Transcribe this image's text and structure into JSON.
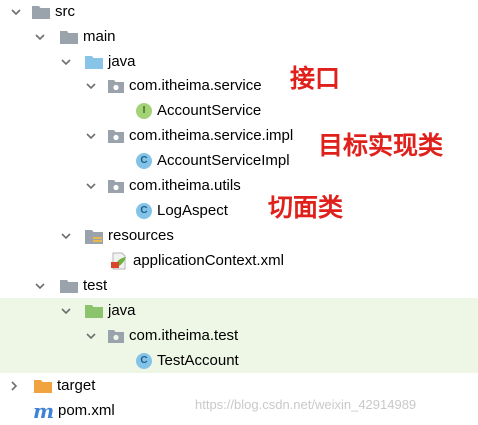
{
  "tree": {
    "src": "src",
    "main": "main",
    "main_java": "java",
    "pkg_service": "com.itheima.service",
    "account_service": "AccountService",
    "pkg_service_impl": "com.itheima.service.impl",
    "account_service_impl": "AccountServiceImpl",
    "pkg_utils": "com.itheima.utils",
    "log_aspect": "LogAspect",
    "resources": "resources",
    "app_context": "applicationContext.xml",
    "test": "test",
    "test_java": "java",
    "pkg_test": "com.itheima.test",
    "test_account": "TestAccount",
    "target": "target",
    "pom": "pom.xml"
  },
  "annotations": {
    "interface": "接口",
    "target_impl": "目标实现类",
    "aspect": "切面类"
  },
  "icons": {
    "interface_badge": "I",
    "class_badge": "C",
    "maven_badge": "m"
  },
  "watermark": "https://blog.csdn.net/weixin_42914989",
  "colors": {
    "folder_gray": "#9aa2ab",
    "source_folder_blue": "#88c3e8",
    "test_folder_green": "#8cc46d",
    "target_folder_orange": "#f0a33e",
    "interface_green": "#a3d277",
    "class_blue": "#84c3e8",
    "annotation_red": "#e0201b",
    "test_row_bg": "#eef7e5"
  }
}
